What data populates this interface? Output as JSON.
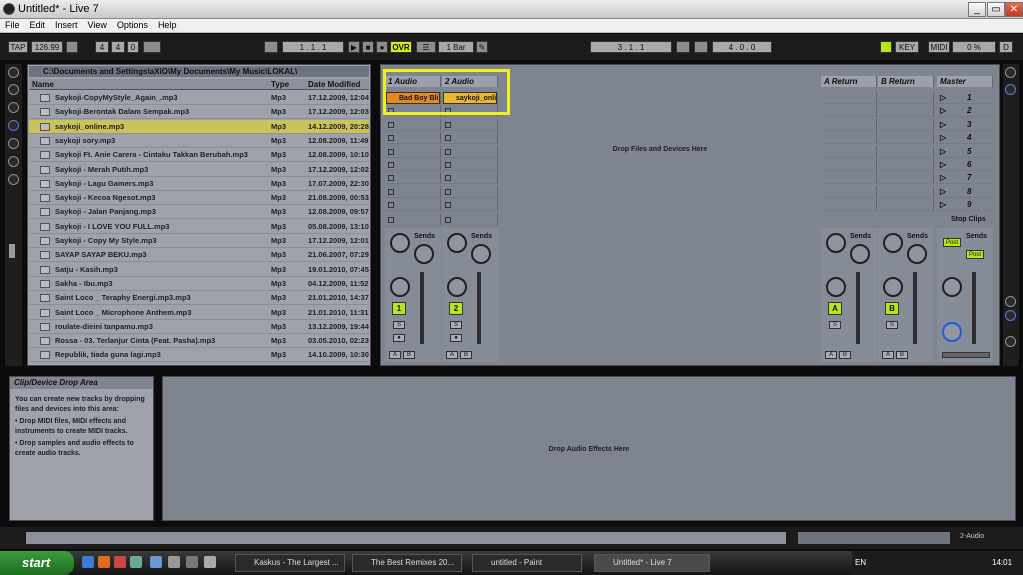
{
  "window": {
    "title": "Untitled* - Live 7",
    "minimize": "_",
    "maximize": "▭",
    "close": "✕"
  },
  "menu": [
    "File",
    "Edit",
    "Insert",
    "View",
    "Options",
    "Help"
  ],
  "transport": {
    "tap": "TAP",
    "tempo": "126.99",
    "sig_num": "4",
    "sig_den": "4",
    "metronome": "0",
    "position": "1 .  1  .  1",
    "ovr": "OVR",
    "quantize": "1 Bar",
    "loop_start": "3 .  1  .  1",
    "loop_length": "4 .  0  .  0",
    "key": "KEY",
    "midi": "MIDI",
    "cpu": "0 %",
    "disk": "D"
  },
  "browser": {
    "path": "C:\\Documents and Settings\\aXiO\\My Documents\\My Music\\LOKAL\\",
    "col_name": "Name",
    "col_type": "Type",
    "col_date": "Date Modified",
    "files": [
      {
        "name": "Saykoji-CopyMyStyle_Again_.mp3",
        "type": "Mp3",
        "date": "17.12.2009, 12:04"
      },
      {
        "name": "Saykoji-Berontak Dalam Sempak.mp3",
        "type": "Mp3",
        "date": "17.12.2009, 12:03"
      },
      {
        "name": "saykoji_online.mp3",
        "type": "Mp3",
        "date": "14.12.2009, 20:28",
        "selected": true
      },
      {
        "name": "saykoji sory.mp3",
        "type": "Mp3",
        "date": "12.08.2009, 11:49"
      },
      {
        "name": "Saykoji Ft. Anie Carera - Cintaku Takkan Berubah.mp3",
        "type": "Mp3",
        "date": "12.08.2009, 10:10"
      },
      {
        "name": "Saykoji - Merah Putih.mp3",
        "type": "Mp3",
        "date": "17.12.2009, 12:02"
      },
      {
        "name": "Saykoji - Lagu Gamers.mp3",
        "type": "Mp3",
        "date": "17.07.2009, 22:30"
      },
      {
        "name": "Saykoji - Kecoa Ngesot.mp3",
        "type": "Mp3",
        "date": "21.08.2009, 00:53"
      },
      {
        "name": "Saykoji - Jalan Panjang.mp3",
        "type": "Mp3",
        "date": "12.08.2009, 09:57"
      },
      {
        "name": "Saykoji - I LOVE YOU FULL.mp3",
        "type": "Mp3",
        "date": "05.08.2009, 13:10"
      },
      {
        "name": "Saykoji - Copy My Style.mp3",
        "type": "Mp3",
        "date": "17.12.2009, 12:01"
      },
      {
        "name": "SAYAP SAYAP BEKU.mp3",
        "type": "Mp3",
        "date": "21.06.2007, 07:29"
      },
      {
        "name": "Satju - Kasih.mp3",
        "type": "Mp3",
        "date": "19.01.2010, 07:45"
      },
      {
        "name": "Sakha - Ibu.mp3",
        "type": "Mp3",
        "date": "04.12.2009, 11:52"
      },
      {
        "name": "Saint Loco _ Teraphy Energi.mp3.mp3",
        "type": "Mp3",
        "date": "21.01.2010, 14:37"
      },
      {
        "name": "Saint Loco _ Microphone Anthem.mp3",
        "type": "Mp3",
        "date": "21.01.2010, 11:31"
      },
      {
        "name": "roulate-dieini tanpamu.mp3",
        "type": "Mp3",
        "date": "13.12.2009, 19:44"
      },
      {
        "name": "Rossa - 03. Terlanjur Cinta (Feat. Pasha).mp3",
        "type": "Mp3",
        "date": "03.05.2010, 02:23"
      },
      {
        "name": "Republik, tiada guna lagi.mp3",
        "type": "Mp3",
        "date": "14.10.2009, 10:30"
      }
    ]
  },
  "session": {
    "track1": "1 Audio",
    "track2": "2 Audio",
    "return_a": "A Return",
    "return_b": "B Return",
    "master": "Master",
    "clip1": "Bad Boy Bli",
    "clip2": "saykoji_onli",
    "drop_files": "Drop Files and Devices Here",
    "scenes": [
      "1",
      "2",
      "3",
      "4",
      "5",
      "6",
      "7",
      "8",
      "9"
    ],
    "stop_clips": "Stop Clips",
    "sends": "Sends",
    "knob_a": "A",
    "knob_b": "B",
    "num1": "1",
    "num2": "2",
    "ret_a": "A",
    "ret_b": "B",
    "solo": "S",
    "post": "Post",
    "xa": "A",
    "xb": "B"
  },
  "info": {
    "title": "Clip/Device Drop Area",
    "text": "You can create new tracks by dropping files and devices into this area:",
    "bullet1": "• Drop MIDI files, MIDI effects and instruments to create MIDI tracks.",
    "bullet2": "• Drop samples and audio effects to create audio tracks."
  },
  "device_drop": "Drop Audio Effects Here",
  "status": {
    "track": "2-Audio"
  },
  "taskbar": {
    "start": "start",
    "tasks": [
      "Kaskus - The Largest ...",
      "The Best Remixes 20...",
      "untitled - Paint",
      "Untitled* - Live 7"
    ],
    "lang": "EN",
    "clock": "14:01"
  }
}
